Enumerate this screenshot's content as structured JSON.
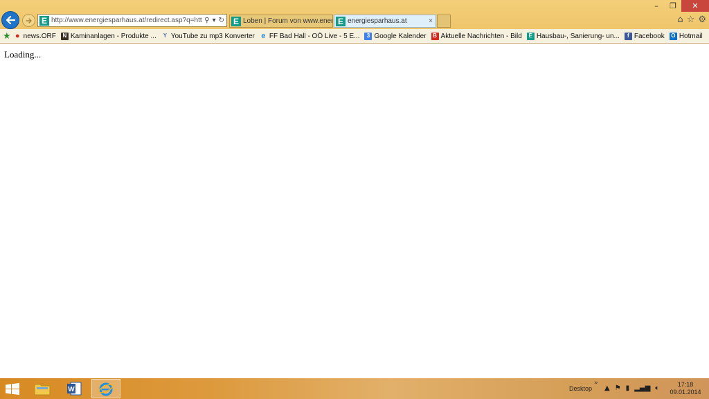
{
  "browser": {
    "address_url": "http://www.energiesparhaus.at/redirect.asp?q=http://",
    "site_icon_letter": "E",
    "tabs": [
      {
        "label": "Loben | Forum von www.energiesparhaus.at",
        "icon_letter": "E",
        "active": false
      },
      {
        "label": "energiesparhaus.at",
        "icon_letter": "E",
        "active": true
      }
    ],
    "tab_close_glyph": "×"
  },
  "favorites": [
    {
      "label": "news.ORF",
      "icon": "orf-icon",
      "color": "#d9241b",
      "glyph": "●"
    },
    {
      "label": "Kaminanlagen - Produkte ...",
      "icon": "kamin-icon",
      "color": "#3a2f25",
      "glyph": "N"
    },
    {
      "label": "YouTube zu mp3 Konverter",
      "icon": "youtube-mp3-icon",
      "color": "#4a6fa8",
      "glyph": "Y"
    },
    {
      "label": "FF Bad Hall - OÖ Live - 5 E...",
      "icon": "ie-page-icon",
      "color": "#3b8fd0",
      "glyph": "e"
    },
    {
      "label": "Google Kalender",
      "icon": "google-calendar-icon",
      "color": "#3f7fe8",
      "glyph": "3"
    },
    {
      "label": "Aktuelle Nachrichten - Bild",
      "icon": "bild-icon",
      "color": "#d42a1e",
      "glyph": "B"
    },
    {
      "label": "Hausbau-, Sanierung- un...",
      "icon": "energiesparhaus-icon",
      "color": "#139b8a",
      "glyph": "E"
    },
    {
      "label": "Facebook",
      "icon": "facebook-icon",
      "color": "#3b5998",
      "glyph": "f"
    },
    {
      "label": "Hotmail",
      "icon": "hotmail-icon",
      "color": "#0a72c6",
      "glyph": "O"
    }
  ],
  "content": {
    "loading_text": "Loading..."
  },
  "taskbar": {
    "desktop_label": "Desktop",
    "time": "17:18",
    "date": "09.01.2014"
  }
}
